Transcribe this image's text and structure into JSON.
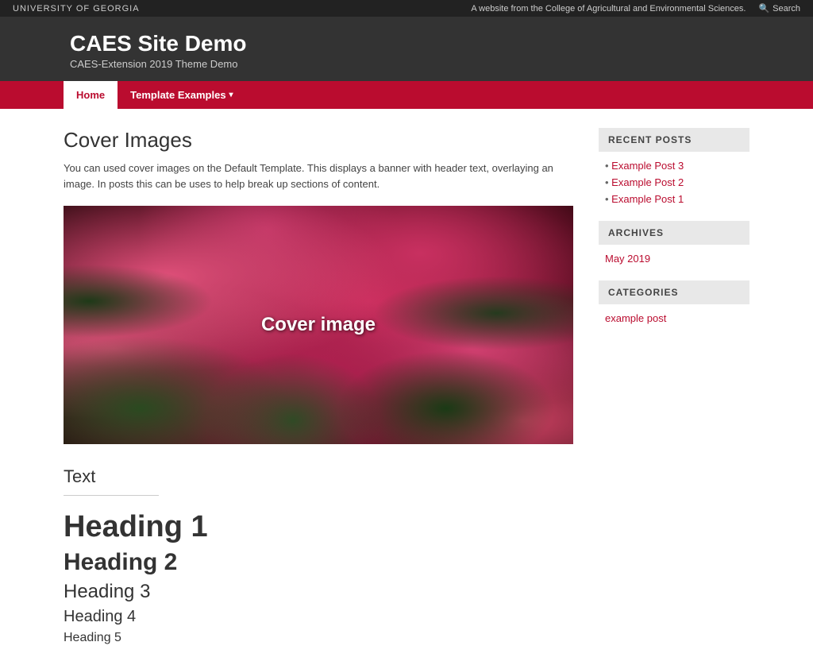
{
  "topBar": {
    "logo": "UNIVERSITY OF GEORGIA",
    "tagline": "A website from the College of Agricultural and Environmental Sciences.",
    "searchLabel": "Search"
  },
  "siteHeader": {
    "title": "CAES Site Demo",
    "subtitle": "CAES-Extension 2019 Theme Demo"
  },
  "nav": {
    "items": [
      {
        "label": "Home",
        "active": true,
        "hasDropdown": false
      },
      {
        "label": "Template Examples",
        "active": false,
        "hasDropdown": true
      }
    ]
  },
  "mainContent": {
    "pageTitle": "Cover Images",
    "description": "You can used cover images on the Default Template. This displays a banner with header text, overlaying an image. In posts this can be uses to help break up sections of content.",
    "coverImageText": "Cover image",
    "textSectionHeading": "Text",
    "headings": [
      {
        "level": "h1",
        "text": "Heading 1"
      },
      {
        "level": "h2",
        "text": "Heading 2"
      },
      {
        "level": "h3",
        "text": "Heading 3"
      },
      {
        "level": "h4",
        "text": "Heading 4"
      },
      {
        "level": "h5",
        "text": "Heading 5"
      }
    ]
  },
  "sidebar": {
    "widgets": [
      {
        "id": "recent-posts",
        "title": "Recent Posts",
        "links": [
          {
            "label": "Example Post 3",
            "href": "#"
          },
          {
            "label": "Example Post 2",
            "href": "#"
          },
          {
            "label": "Example Post 1",
            "href": "#"
          }
        ]
      },
      {
        "id": "archives",
        "title": "Archives",
        "links": [
          {
            "label": "May 2019",
            "href": "#"
          }
        ]
      },
      {
        "id": "categories",
        "title": "Categories",
        "links": [
          {
            "label": "example post",
            "href": "#"
          }
        ]
      }
    ]
  }
}
